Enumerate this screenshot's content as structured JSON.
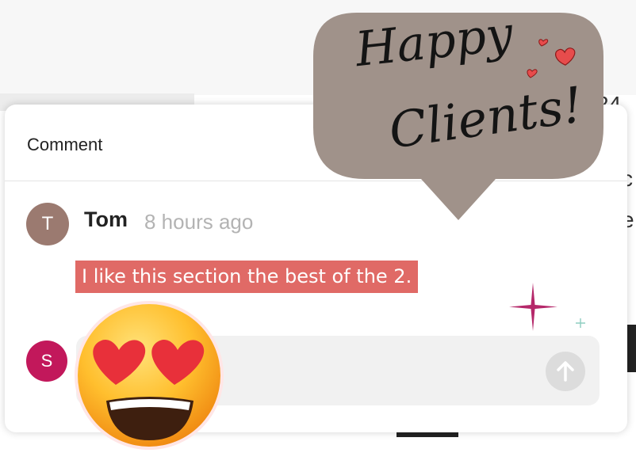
{
  "dialog": {
    "title": "Comment",
    "close_glyph": "✕"
  },
  "comment": {
    "avatar_initial": "T",
    "author": "Tom",
    "time": "8 hours ago",
    "text": "I like this section the best of the 2."
  },
  "reply": {
    "avatar_initial": "S",
    "send_icon": "arrow-up-icon"
  },
  "overlay": {
    "line1": "Happy",
    "line2": "Clients!",
    "bubble_color": "#a0928a",
    "highlight_color": "#e06a66"
  },
  "background": {
    "fragments": [
      "24",
      "c",
      "e"
    ]
  }
}
